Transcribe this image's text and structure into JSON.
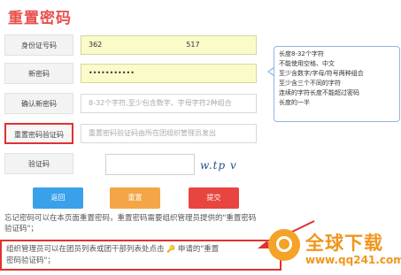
{
  "page": {
    "title": "重置密码"
  },
  "form": {
    "id_label": "身份证号码",
    "id_value_prefix": "362",
    "id_value_suffix": "517",
    "newpw_label": "新密码",
    "newpw_value": "•••••••••••",
    "confirm_label": "确认新密码",
    "confirm_placeholder": "8-32个字符,至少包含数字、字母字符2种组合",
    "resetcode_label": "重置密码验证码",
    "resetcode_placeholder": "重置密码验证码由所在团组织管理员发出",
    "captcha_label": "验证码",
    "captcha_text": "w.tp v"
  },
  "tip": {
    "lines": [
      "长度8-32个字符",
      "不能使用空格、中文",
      "至少含数字/字母/符号两种组合",
      "至少含三个不同的字符",
      "连续的字符长度不能超过密码",
      "长度的一半"
    ]
  },
  "buttons": {
    "back": "返回",
    "reset": "重置",
    "submit": "提交"
  },
  "notes": {
    "note1": "忘记密码可以在本页面重置密码，重置密码需要组织管理员提供的\"重置密码验证码\"；",
    "note2_a": "组织管理员可以在团员列表或团干部列表处点击",
    "note2_key": "🔑",
    "note2_b": "申请的\"重置",
    "note2_c": "密码验证码\"；"
  },
  "watermark": {
    "name": "全球下载",
    "url": "www.qq241.com"
  },
  "colors": {
    "title": "#e8504d",
    "highlight": "#e0322f",
    "back": "#3aa0ea",
    "reset": "#f3a646",
    "submit": "#e94540",
    "watermark": "#f0961c"
  }
}
